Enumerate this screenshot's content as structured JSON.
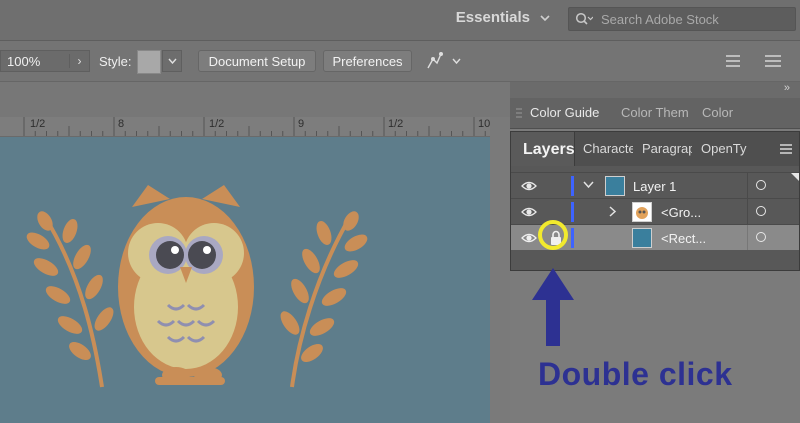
{
  "appbar": {
    "workspace": "Essentials",
    "search_placeholder": "Search Adobe Stock"
  },
  "controlbar": {
    "zoom_value": "100%",
    "style_label": "Style:",
    "document_setup": "Document Setup",
    "preferences": "Preferences"
  },
  "ruler": {
    "labels": [
      "1/2",
      "8",
      "1/2",
      "9",
      "1/2",
      "10"
    ]
  },
  "panels": {
    "color_guide_tabs": [
      "Color Guide",
      "Color Them",
      "Color"
    ],
    "layer_tabs": [
      "Layers",
      "Characte",
      "Paragrap",
      "OpenTy"
    ],
    "layers": [
      {
        "name": "Layer 1",
        "expanded": true
      },
      {
        "name": "<Gro..."
      },
      {
        "name": "<Rect...",
        "locked": true,
        "selected": true
      }
    ]
  },
  "annotation": {
    "text": "Double click",
    "circle_color": "#f2ea2e",
    "text_color": "#2d3192"
  },
  "colors": {
    "artboard": "#5e7d8b",
    "owl_body": "#c98e57",
    "owl_belly": "#d7c78d",
    "layer_color": "#3d63ff",
    "selected_row": "#8a8a8a"
  }
}
